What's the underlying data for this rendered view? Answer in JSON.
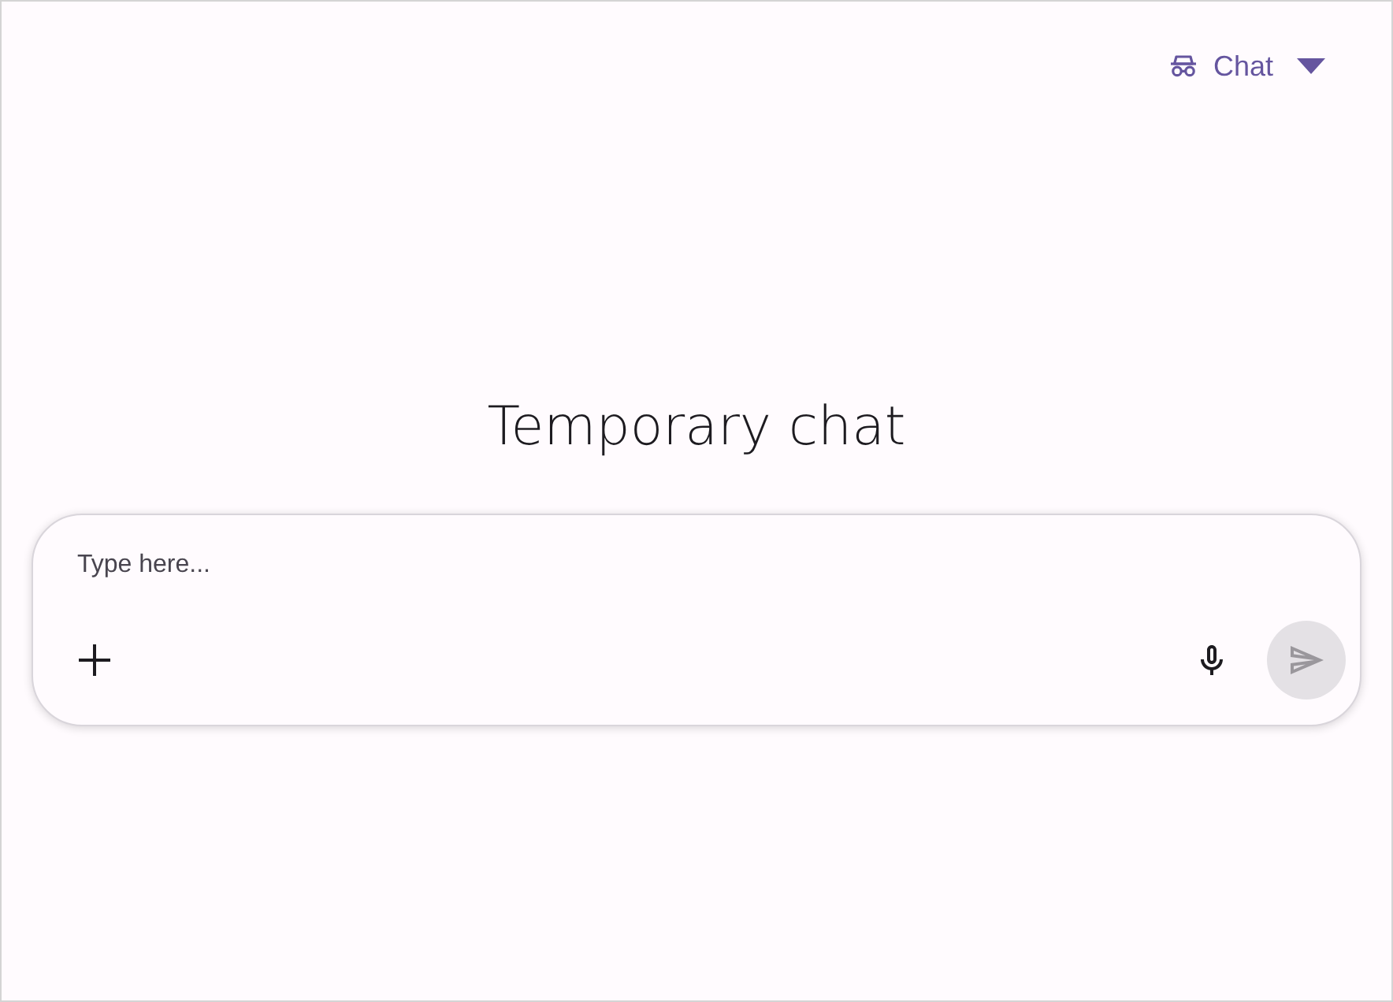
{
  "header": {
    "mode_menu": {
      "label": "Chat"
    }
  },
  "title": "Temporary chat",
  "composer": {
    "placeholder": "Type here...",
    "send_button": {
      "disabled": true
    }
  }
}
